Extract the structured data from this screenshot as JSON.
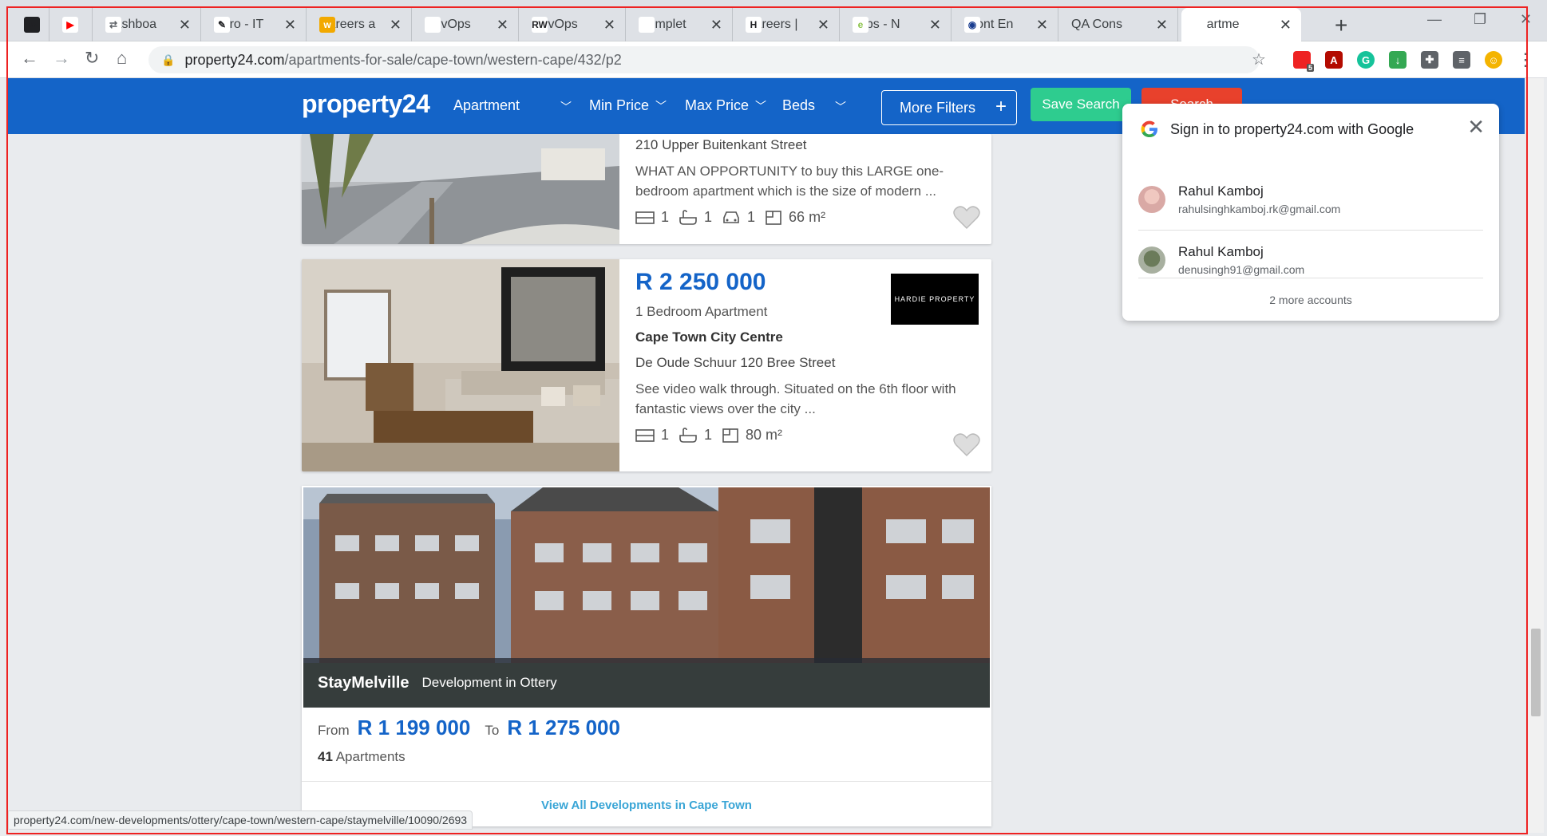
{
  "browser": {
    "tabs": [
      {
        "label": "",
        "icon": "code-icon",
        "color": "#202124",
        "glyph": "‹/›"
      },
      {
        "label": "",
        "icon": "youtube-icon",
        "color": "#ff0000",
        "glyph": "▶"
      },
      {
        "label": "Dashboa",
        "icon": "dashboard-icon",
        "color": "#5f6368",
        "glyph": "⇄"
      },
      {
        "label": "Xero - IT",
        "icon": "xero-icon",
        "color": "#202124",
        "glyph": "✎"
      },
      {
        "label": "Careers a",
        "icon": "workable-icon",
        "color": "#ffffff",
        "glyph": "w"
      },
      {
        "label": "DevOps",
        "icon": "id-icon",
        "color": "#ffffff",
        "glyph": "id."
      },
      {
        "label": "DevOps",
        "icon": "rw-icon",
        "color": "#202124",
        "glyph": "RW"
      },
      {
        "label": "Complet",
        "icon": "u-icon",
        "color": "#ffffff",
        "glyph": "u"
      },
      {
        "label": "Careers |",
        "icon": "h-icon",
        "color": "#202124",
        "glyph": "H"
      },
      {
        "label": "Jobs - N",
        "icon": "jobs-icon",
        "color": "#8bc34a",
        "glyph": "e"
      },
      {
        "label": "Front En",
        "icon": "globe-icon",
        "color": "#1a3d8f",
        "glyph": "◉"
      },
      {
        "label": "QA Cons",
        "icon": "qa-icon",
        "color": "#dee1e6",
        "glyph": ""
      },
      {
        "label": "Apartme",
        "icon": "p24-icon",
        "color": "#ffffff",
        "glyph": "p24"
      }
    ],
    "new_tab": "+",
    "url_host": "property24.com",
    "url_path": "/apartments-for-sale/cape-town/western-cape/432/p2",
    "ext_badge": "5",
    "status_url": "property24.com/new-developments/ottery/cape-town/western-cape/staymelville/10090/2693"
  },
  "header": {
    "logo": "property24",
    "type": "Apartment",
    "min_price": "Min Price",
    "max_price": "Max Price",
    "beds": "Beds",
    "more_filters": "More Filters",
    "save_search": "Save Search",
    "search": "Search",
    "primary_color": "#1464c8"
  },
  "listings": [
    {
      "address": "210 Upper Buitenkant Street",
      "description": "WHAT AN OPPORTUNITY to buy this LARGE one-bedroom apartment which is the size of modern ...",
      "beds": "1",
      "baths": "1",
      "parking": "1",
      "size": "66 m²"
    },
    {
      "price": "R 2 250 000",
      "type": "1 Bedroom Apartment",
      "suburb": "Cape Town City Centre",
      "address": "De Oude Schuur 120 Bree Street",
      "description": "See video walk through. Situated on the 6th floor with fantastic views over the city ...",
      "beds": "1",
      "baths": "1",
      "size": "80 m²",
      "agency": "HARDIE PROPERTY"
    }
  ],
  "development": {
    "name": "StayMelville",
    "subtitle": "Development in Ottery",
    "from_label": "From",
    "from_price": "R 1 199 000",
    "to_label": "To",
    "to_price": "R 1 275 000",
    "count": "41",
    "count_label": " Apartments",
    "link": "View All Developments in Cape Town"
  },
  "google_popup": {
    "title": "Sign in to property24.com with Google",
    "accounts": [
      {
        "name": "Rahul Kamboj",
        "email": "rahulsinghkamboj.rk@gmail.com"
      },
      {
        "name": "Rahul Kamboj",
        "email": "denusingh91@gmail.com"
      }
    ],
    "more": "2 more accounts"
  }
}
